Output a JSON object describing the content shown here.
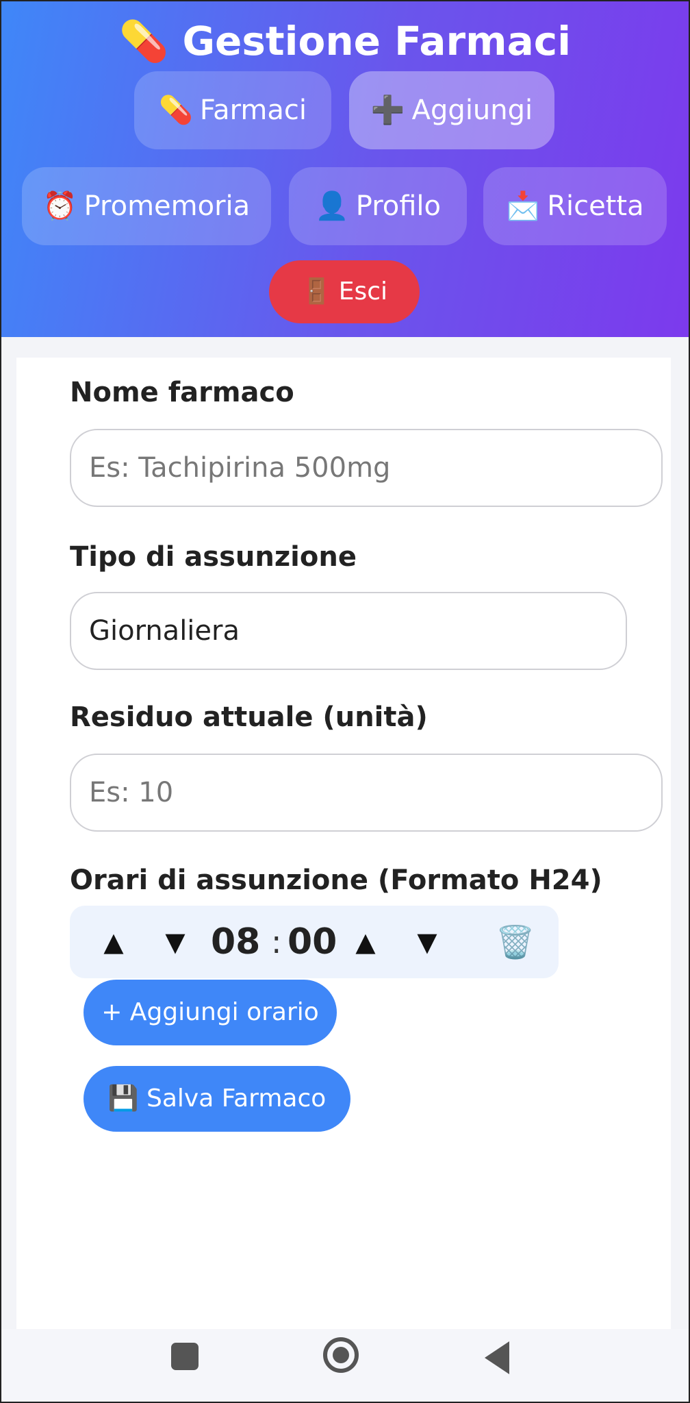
{
  "header": {
    "title": "Gestione Farmaci",
    "title_icon": "💊",
    "nav": [
      {
        "icon": "💊",
        "label": "Farmaci"
      },
      {
        "icon": "➕",
        "label": "Aggiungi"
      },
      {
        "icon": "⏰",
        "label": "Promemoria"
      },
      {
        "icon": "👤",
        "label": "Profilo"
      },
      {
        "icon": "📩",
        "label": "Ricetta"
      }
    ],
    "logout": {
      "icon": "🚪",
      "label": "Esci"
    }
  },
  "form": {
    "name_label": "Nome farmaco",
    "name_placeholder": "Es: Tachipirina 500mg",
    "type_label": "Tipo di assunzione",
    "type_value": "Giornaliera",
    "residue_label": "Residuo attuale (unità)",
    "residue_placeholder": "Es: 10",
    "times_label": "Orari di assunzione (Formato H24)",
    "time": {
      "hour": "08",
      "minute": "00",
      "separator": ":"
    },
    "arrows": {
      "up": "▲",
      "down": "▼"
    },
    "trash_icon": "🗑️",
    "add_time_label": "+ Aggiungi orario",
    "save_icon": "💾",
    "save_label": "Salva Farmaco"
  },
  "colors": {
    "header_gradient_start": "#3f87f8",
    "header_gradient_end": "#7c3aed",
    "primary": "#3f87f8",
    "danger": "#e63946"
  }
}
